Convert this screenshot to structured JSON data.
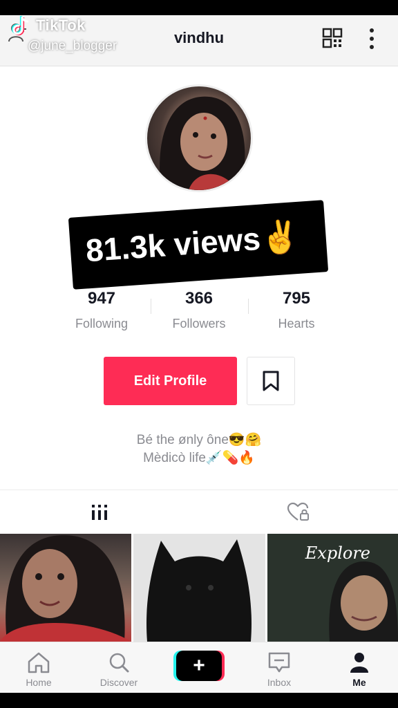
{
  "watermark": {
    "brand": "TikTok",
    "handle": "@june_blogger"
  },
  "header": {
    "title": "vindhu"
  },
  "sticker": {
    "views": "81.3k views✌"
  },
  "stats": [
    {
      "value": "947",
      "label": "Following"
    },
    {
      "value": "366",
      "label": "Followers"
    },
    {
      "value": "795",
      "label": "Hearts"
    }
  ],
  "actions": {
    "edit_profile": "Edit Profile"
  },
  "bio": {
    "line1": "Bé the ønly ône😎🤗",
    "line2": "Mèdicò life💉💊🔥"
  },
  "grid": {
    "thumb3_overlay": "Explore"
  },
  "nav": {
    "home": "Home",
    "discover": "Discover",
    "create": "+",
    "inbox": "Inbox",
    "me": "Me"
  },
  "colors": {
    "accent": "#fe2c55",
    "cyan": "#25f4ee",
    "text": "#161823",
    "muted": "#8a8b91"
  }
}
